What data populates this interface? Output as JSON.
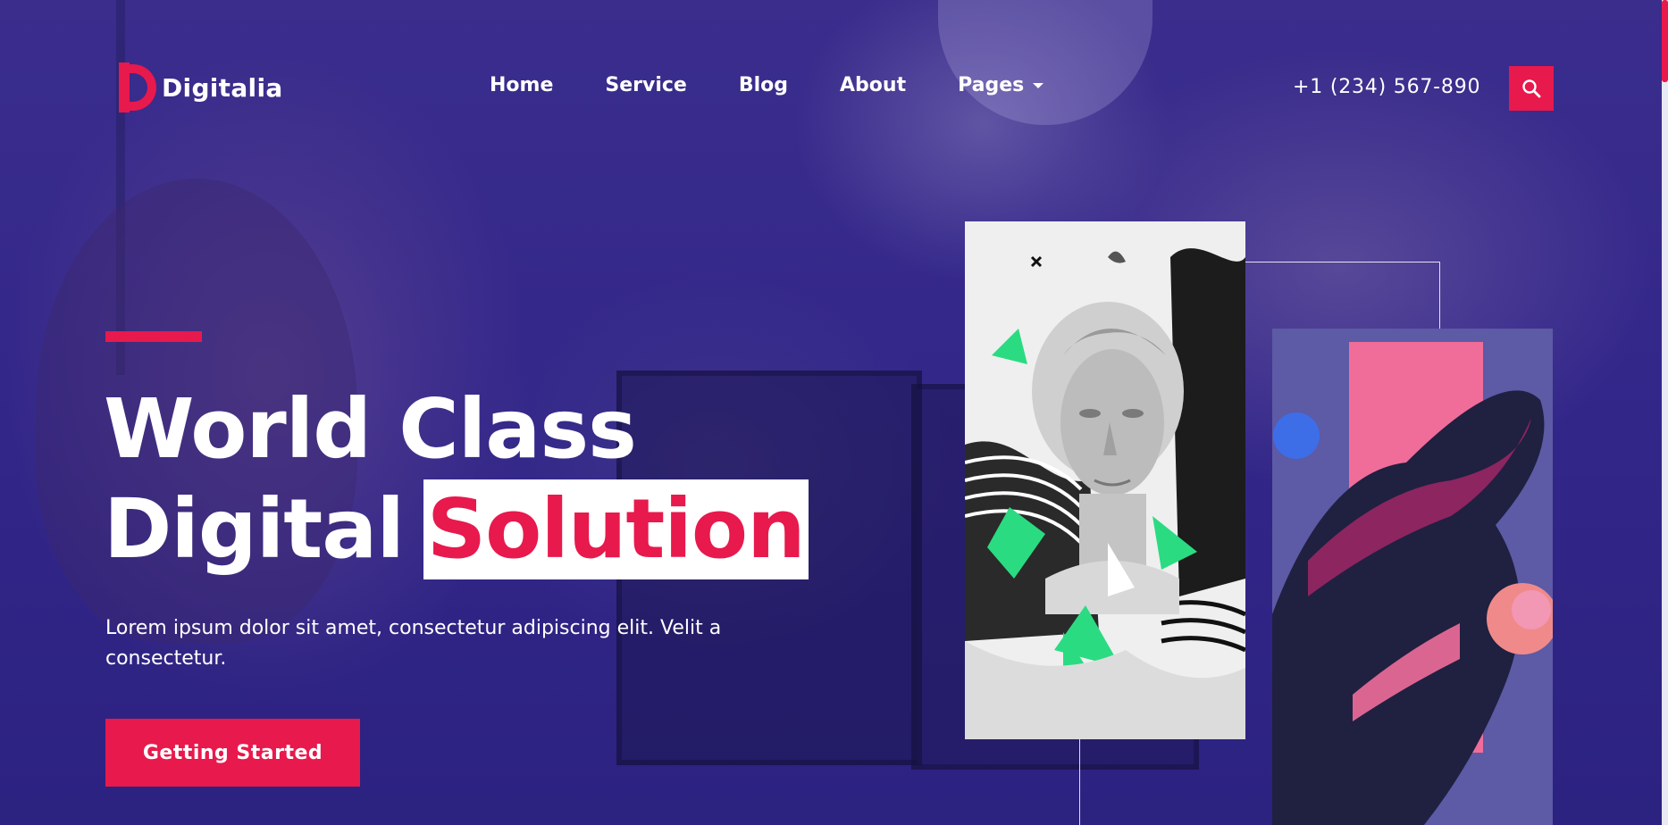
{
  "brand": {
    "name": "Digitalia",
    "accent_color": "#e8194c",
    "background_color": "#33278a"
  },
  "nav": {
    "items": [
      {
        "label": "Home"
      },
      {
        "label": "Service"
      },
      {
        "label": "Blog"
      },
      {
        "label": "About"
      },
      {
        "label": "Pages",
        "has_dropdown": true
      }
    ],
    "phone": "+1 (234) 567-890",
    "search_icon": "search-icon"
  },
  "hero": {
    "headline_line1": "World Class",
    "headline_line2_prefix": "Digital",
    "headline_highlight": "Solution",
    "subtext": "Lorem ipsum dolor sit amet, consectetur adipiscing elit. Velit a consectetur.",
    "cta_label": "Getting Started"
  }
}
